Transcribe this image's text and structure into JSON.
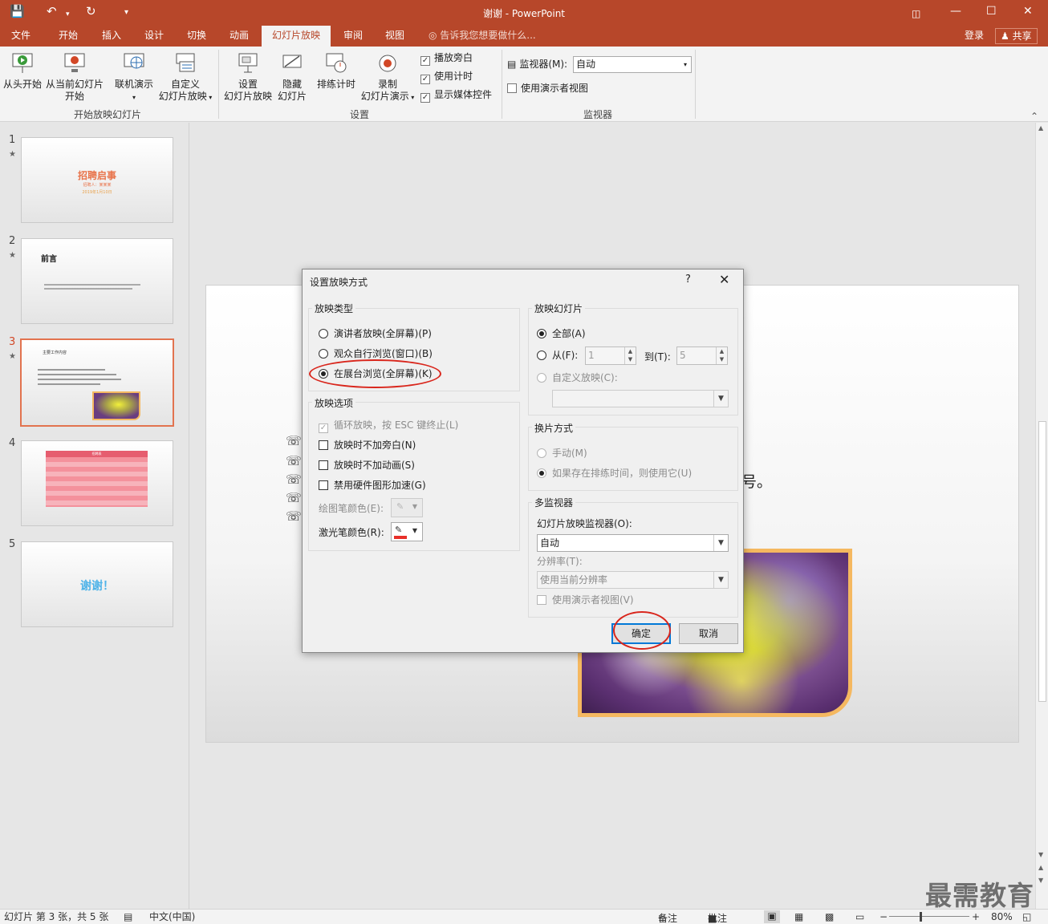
{
  "window": {
    "title": "谢谢 - PowerPoint",
    "minimize_icon": "minimize-icon",
    "maximize_icon": "maximize-icon",
    "close_icon": "close-icon"
  },
  "tabs": [
    "文件",
    "开始",
    "插入",
    "设计",
    "切换",
    "动画",
    "幻灯片放映",
    "审阅",
    "视图"
  ],
  "active_tab": "幻灯片放映",
  "tell_me": "告诉我您想要做什么...",
  "login": "登录",
  "share": "共享",
  "ribbon": {
    "from_start": "从头开始",
    "from_current_1": "从当前幻灯片",
    "from_current_2": "开始",
    "online_present": "联机演示",
    "custom_1": "自定义",
    "custom_2": "幻灯片放映",
    "group_start": "开始放映幻灯片",
    "setup_1": "设置",
    "setup_2": "幻灯片放映",
    "hide_1": "隐藏",
    "hide_2": "幻灯片",
    "rehearse": "排练计时",
    "record_1": "录制",
    "record_2": "幻灯片演示",
    "play_narration": "播放旁白",
    "use_timings": "使用计时",
    "show_media": "显示媒体控件",
    "group_setup": "设置",
    "monitor_label": "监视器(M):",
    "monitor_value": "自动",
    "presenter_view": "使用演示者视图",
    "group_monitor": "监视器"
  },
  "thumbnails": [
    {
      "num": "1",
      "title": "招聘启事",
      "sub1": "招聘人：某某某",
      "sub2": "2019年1月10日"
    },
    {
      "num": "2",
      "title": "前言"
    },
    {
      "num": "3",
      "title": "主要工作内容"
    },
    {
      "num": "4",
      "title": "招聘表"
    },
    {
      "num": "5",
      "title": "谢谢！"
    }
  ],
  "slide": {
    "trail_text": "号。"
  },
  "dialog": {
    "title": "设置放映方式",
    "help": "?",
    "close": "✕",
    "show_type": {
      "legend": "放映类型",
      "presenter": "演讲者放映(全屏幕)(P)",
      "individual": "观众自行浏览(窗口)(B)",
      "kiosk": "在展台浏览(全屏幕)(K)"
    },
    "show_options": {
      "legend": "放映选项",
      "loop": "循环放映，按 ESC 键终止(L)",
      "no_narration": "放映时不加旁白(N)",
      "no_animation": "放映时不加动画(S)",
      "no_hw_accel": "禁用硬件图形加速(G)",
      "pen_color": "绘图笔颜色(E):",
      "laser_color": "激光笔颜色(R):"
    },
    "show_slides": {
      "legend": "放映幻灯片",
      "all": "全部(A)",
      "from": "从(F):",
      "from_value": "1",
      "to": "到(T):",
      "to_value": "5",
      "custom": "自定义放映(C):"
    },
    "advance": {
      "legend": "换片方式",
      "manual": "手动(M)",
      "timings": "如果存在排练时间，则使用它(U)"
    },
    "multi_monitor": {
      "legend": "多监视器",
      "monitor_label": "幻灯片放映监视器(O):",
      "monitor_value": "自动",
      "resolution_label": "分辨率(T):",
      "resolution_value": "使用当前分辨率",
      "presenter_view": "使用演示者视图(V)"
    },
    "ok": "确定",
    "cancel": "取消"
  },
  "colors": {
    "accent": "#b7472a",
    "highlight": "#d9261c",
    "laser": "#e8302a"
  },
  "status": {
    "slide_info": "幻灯片 第 3 张，共 5 张",
    "language": "中文(中国)",
    "notes": "备注",
    "comments": "批注",
    "zoom": "80%"
  },
  "watermark": "最需教育"
}
